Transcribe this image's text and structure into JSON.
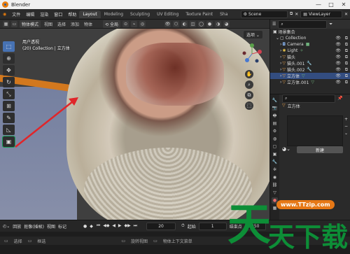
{
  "window": {
    "title": "Blender",
    "controls": [
      "—",
      "□",
      "✕"
    ]
  },
  "menubar": {
    "menus": [
      "文件",
      "编辑",
      "渲染",
      "窗口",
      "帮助"
    ],
    "workspaces": [
      "Layout",
      "Modeling",
      "Sculpting",
      "UV Editing",
      "Texture Paint",
      "Sha"
    ],
    "active_workspace": "Layout",
    "scene_label": "Scene",
    "viewlayer_label": "ViewLayer"
  },
  "viewport_header": {
    "mode": "物体模式",
    "menus": [
      "视图",
      "选择",
      "添加",
      "物体"
    ],
    "transform": "全局",
    "options": "选项"
  },
  "viewport": {
    "view_name": "用户透视",
    "info": "(20) Collection | 立方体"
  },
  "toolbar": {
    "tools": [
      "select-box-icon",
      "cursor-icon",
      "move-icon",
      "rotate-icon",
      "scale-icon",
      "transform-icon",
      "annotate-icon",
      "measure-icon",
      "add-cube-icon"
    ],
    "glyphs": [
      "⬚",
      "⊕",
      "✥",
      "↻",
      "⤡",
      "⊞",
      "✎",
      "📐",
      "▣"
    ]
  },
  "nav_buttons": [
    "✋",
    "⌕",
    "⧉",
    "⬚"
  ],
  "outliner": {
    "root": "场景集合",
    "items": [
      {
        "label": "Collection",
        "type": "collection",
        "indent": 1
      },
      {
        "label": "Camera",
        "type": "camera",
        "indent": 2
      },
      {
        "label": "Light",
        "type": "light",
        "indent": 2
      },
      {
        "label": "猫头",
        "type": "mesh",
        "indent": 2
      },
      {
        "label": "猫头.001",
        "type": "mesh",
        "indent": 2
      },
      {
        "label": "猫头.002",
        "type": "mesh",
        "indent": 2
      },
      {
        "label": "立方体",
        "type": "mesh",
        "indent": 2,
        "selected": true
      },
      {
        "label": "立方体.001",
        "type": "mesh",
        "indent": 2
      }
    ]
  },
  "properties": {
    "object_name": "立方体",
    "new_button": "新建"
  },
  "timeline": {
    "menus": [
      "回放",
      "抠像(插帧)",
      "视图",
      "标记"
    ],
    "current_frame": "20",
    "start_label": "起始",
    "start_value": "1",
    "end_label": "结束点",
    "end_value": "250"
  },
  "status": {
    "items": [
      "选择",
      "框选",
      "旋转视图",
      "物体上下文菜单"
    ]
  },
  "watermark": {
    "chars": [
      "天",
      "天",
      "下",
      "载"
    ],
    "url": "www.TTzip.com"
  },
  "colors": {
    "accent": "#4772b3",
    "selection": "#334d80",
    "arrow": "#e0262a",
    "watermark_green": "#0d8e37",
    "watermark_orange": "#e67816"
  }
}
